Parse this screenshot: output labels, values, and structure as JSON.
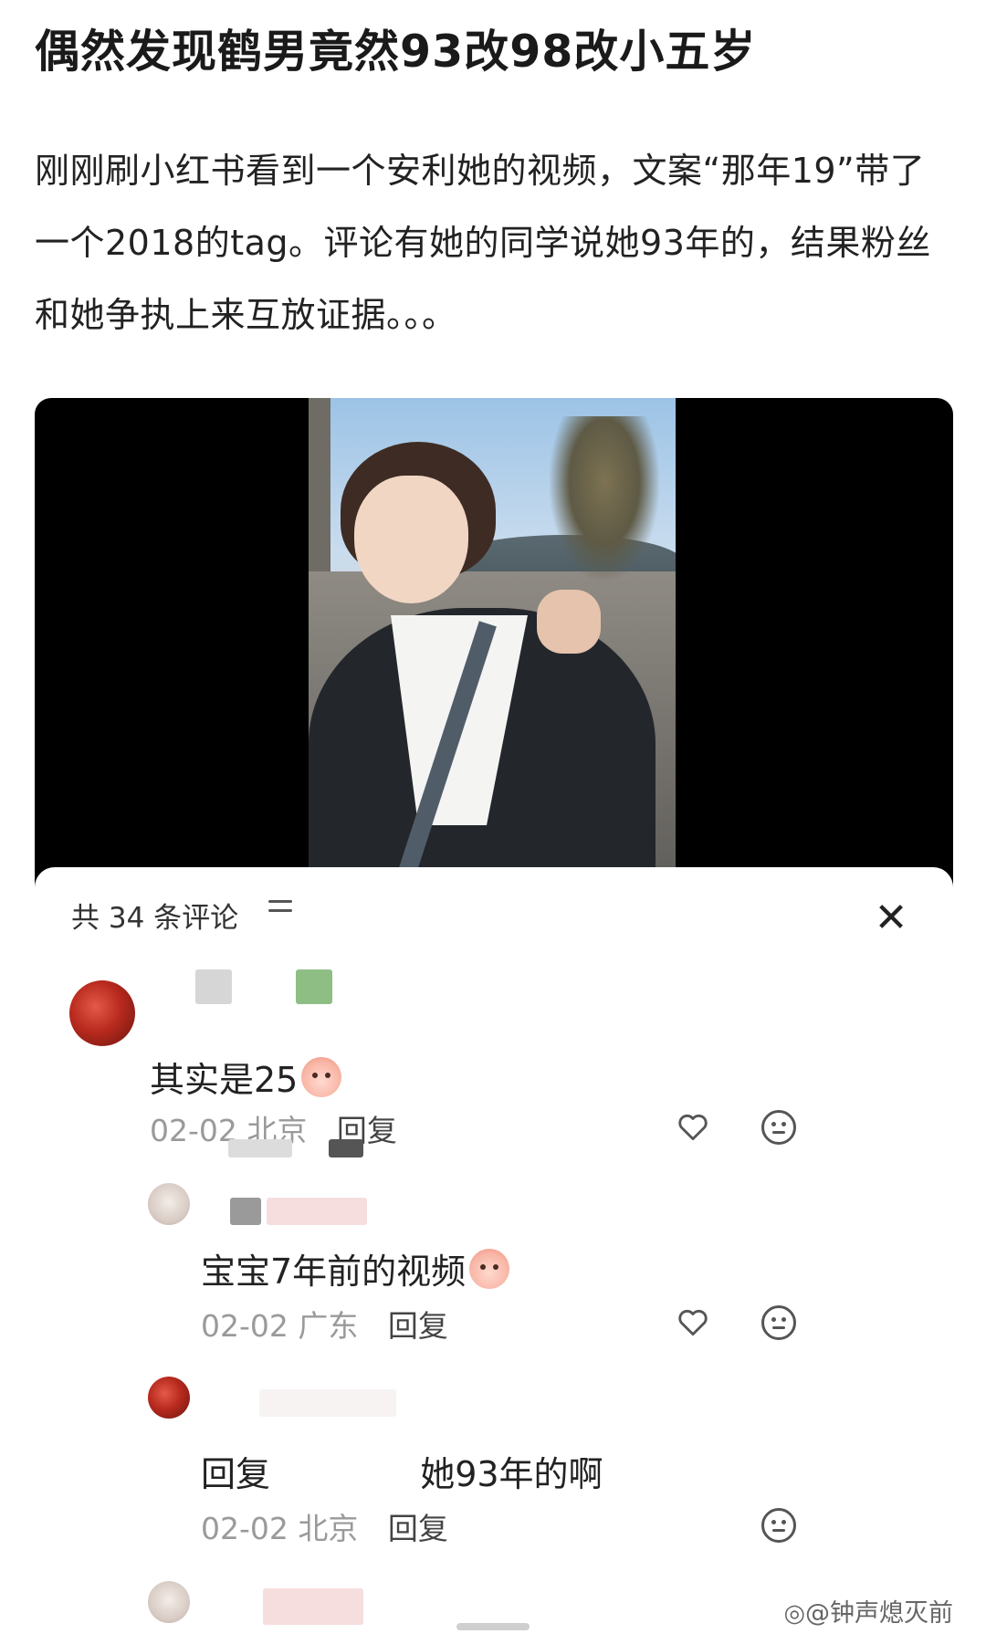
{
  "post": {
    "title": "偶然发现鹤男竟然93改98改小五岁",
    "body": "刚刚刷小红书看到一个安利她的视频，文案“那年19”带了一个2018的tag。评论有她的同学说她93年的，结果粉丝和她争执上来互放证据。。。"
  },
  "comments_panel": {
    "header": "共 34 条评论",
    "sort_icon": "sort-lines-icon",
    "close_icon": "close-x-icon",
    "comments": [
      {
        "text": "其实是25",
        "date": "02-02",
        "location": "北京",
        "reply_label": "回复",
        "emoji": "laughing-crying-face"
      },
      {
        "text": "宝宝7年前的视频",
        "date": "02-02",
        "location": "广东",
        "reply_label": "回复",
        "emoji": "smiling-peach-face"
      },
      {
        "text_prefix": "回复",
        "text": "她93年的啊",
        "date": "02-02",
        "location": "北京",
        "reply_label": "回复"
      }
    ]
  },
  "watermark": "◎@钟声熄灭前",
  "colors": {
    "meta_gray": "#9a9a9a",
    "video_bg": "#000000"
  }
}
